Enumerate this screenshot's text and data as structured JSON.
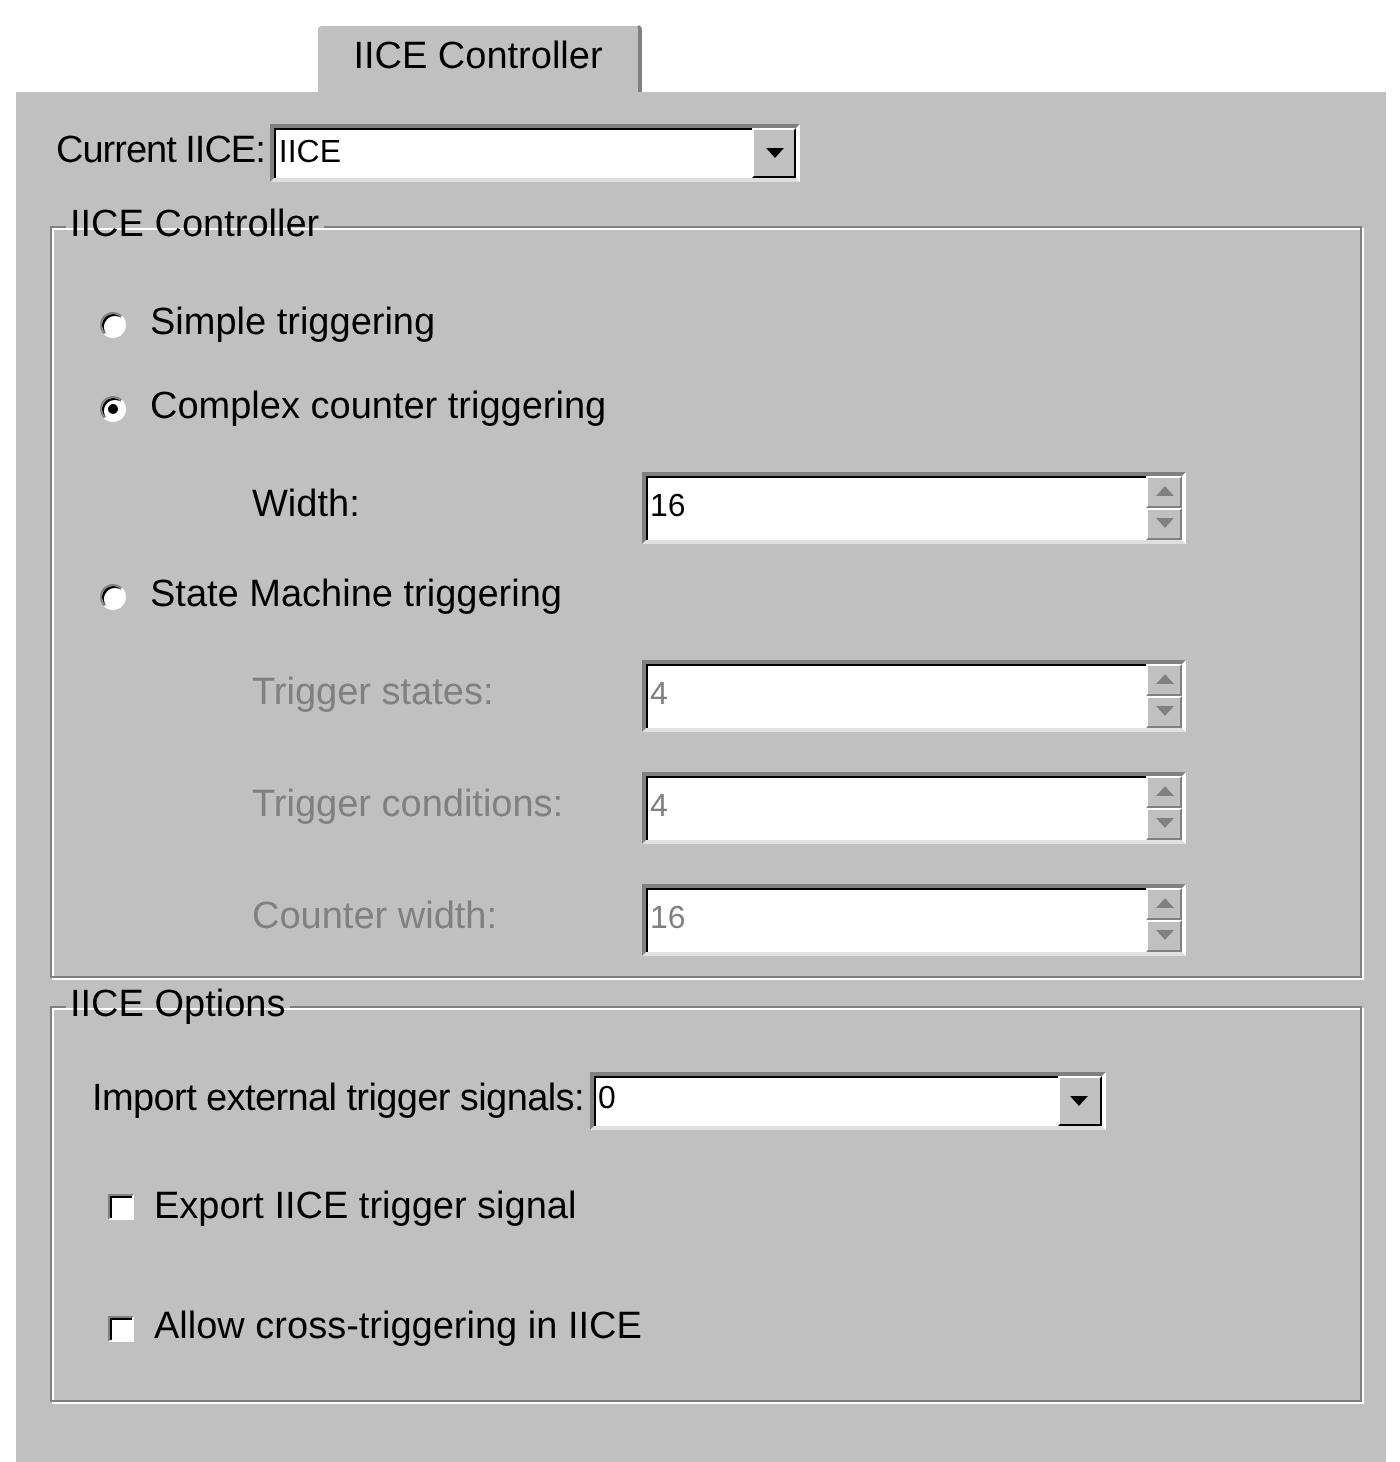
{
  "tabs": [
    {
      "label": "IICE Controller",
      "selected": true
    }
  ],
  "current_iice": {
    "label": "Current IICE:",
    "value": "IICE"
  },
  "controller_group": {
    "title": "IICE Controller",
    "options": [
      {
        "label": "Simple triggering",
        "selected": false
      },
      {
        "label": "Complex counter triggering",
        "selected": true,
        "fields": [
          {
            "label": "Width:",
            "value": "16",
            "disabled": false
          }
        ]
      },
      {
        "label": "State Machine triggering",
        "selected": false,
        "fields": [
          {
            "label": "Trigger states:",
            "value": "4",
            "disabled": true
          },
          {
            "label": "Trigger conditions:",
            "value": "4",
            "disabled": true
          },
          {
            "label": "Counter width:",
            "value": "16",
            "disabled": true
          }
        ]
      }
    ]
  },
  "options_group": {
    "title": "IICE Options",
    "import": {
      "label": "Import external trigger signals:",
      "value": "0"
    },
    "checkboxes": [
      {
        "label": "Export IICE trigger signal",
        "checked": false
      },
      {
        "label": "Allow cross-triggering in IICE",
        "checked": false
      }
    ]
  }
}
